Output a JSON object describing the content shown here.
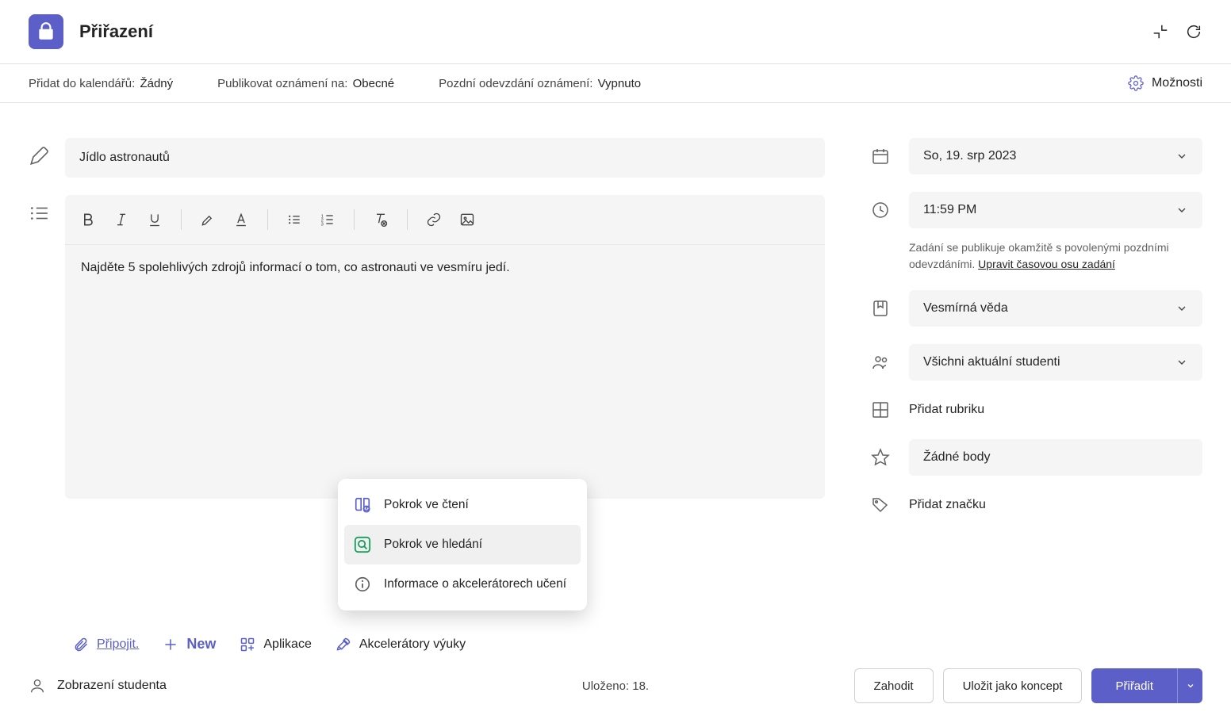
{
  "header": {
    "app_title": "Přiřazení"
  },
  "settings_bar": {
    "calendar_label": "Přidat do kalendářů:",
    "calendar_value": "Žádný",
    "publish_label": "Publikovat oznámení na:",
    "publish_value": "Obecné",
    "late_label": "Pozdní odevzdání oznámení:",
    "late_value": "Vypnuto",
    "options_label": "Možnosti"
  },
  "editor": {
    "title_value": "Jídlo astronautů",
    "body_text": "Najděte 5 spolehlivých zdrojů informací o tom, co astronauti ve vesmíru jedí."
  },
  "accel_menu": {
    "reading": "Pokrok ve čtení",
    "search": "Pokrok ve hledání",
    "info": "Informace o akcelerátorech učení"
  },
  "attach_row": {
    "attach": "Připojit.",
    "new": "New",
    "apps": "Aplikace",
    "accel": "Akcelerátory výuky"
  },
  "right": {
    "date_value": "So, 19. srp 2023",
    "time_value": "11:59 PM",
    "note_text": "Zadání se publikuje okamžitě s povolenými pozdními odevzdáními.",
    "note_link": "Upravit časovou osu zadání",
    "subject_value": "Vesmírná věda",
    "students_value": "Všichni aktuální studenti",
    "rubric_label": "Přidat rubriku",
    "points_value": "Žádné body",
    "tag_label": "Přidat značku"
  },
  "footer": {
    "student_view": "Zobrazení studenta",
    "saved": "Uloženo: 18.",
    "discard": "Zahodit",
    "save_draft": "Uložit jako koncept",
    "assign": "Přiřadit"
  }
}
